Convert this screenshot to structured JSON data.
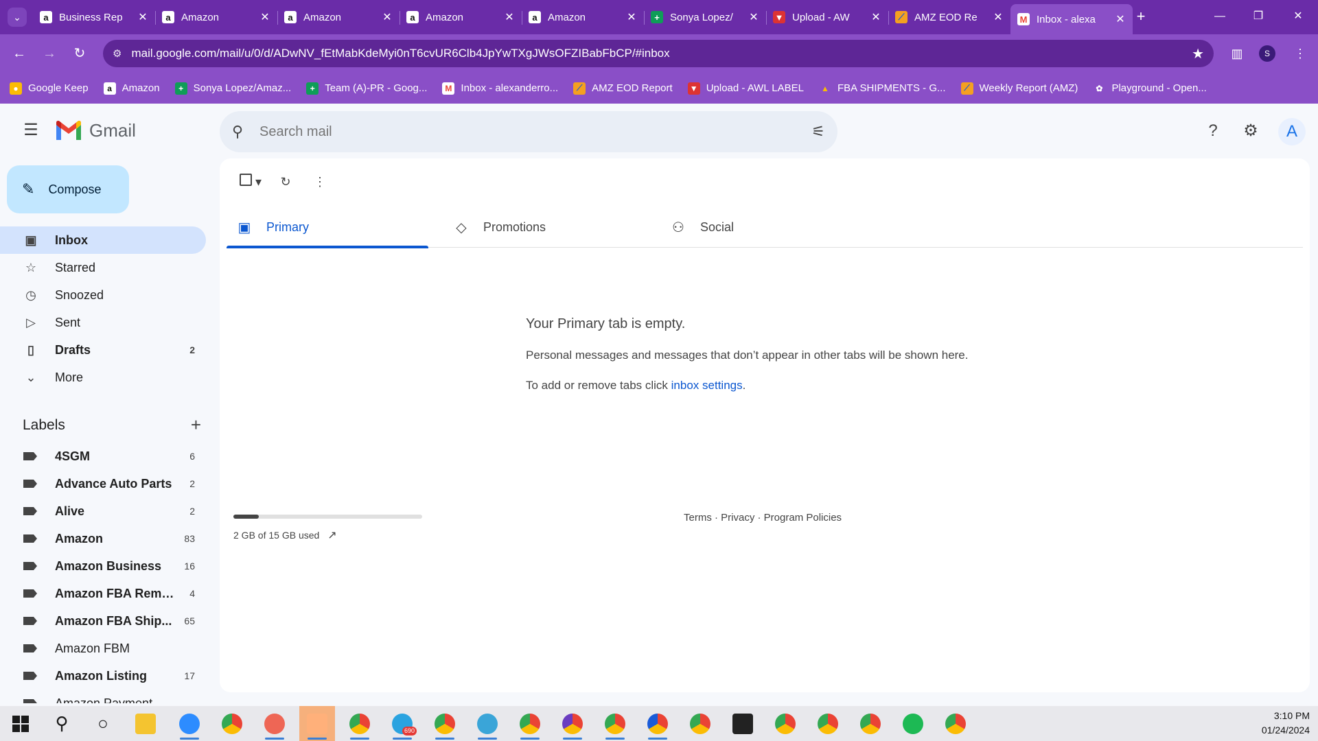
{
  "browser": {
    "tabs": [
      {
        "title": "Business Rep",
        "favicon": "amazon-icon"
      },
      {
        "title": "Amazon",
        "favicon": "amazon-icon"
      },
      {
        "title": "Amazon",
        "favicon": "amazon-icon"
      },
      {
        "title": "Amazon",
        "favicon": "amazon-icon"
      },
      {
        "title": "Amazon",
        "favicon": "amazon-icon"
      },
      {
        "title": "Sonya Lopez/",
        "favicon": "sheets-icon"
      },
      {
        "title": "Upload - AW",
        "favicon": "awl-icon"
      },
      {
        "title": "AMZ EOD Re",
        "favicon": "report-icon"
      },
      {
        "title": "Inbox - alexa",
        "favicon": "gmail-icon"
      }
    ],
    "active_tab_index": 8,
    "url": "mail.google.com/mail/u/0/d/ADwNV_fEtMabKdeMyi0nT6cvUR6Clb4JpYwTXgJWsOFZIBabFbCP/#inbox",
    "profile_initial": "S",
    "bookmarks": [
      {
        "label": "Google Keep",
        "icon": "keep-icon"
      },
      {
        "label": "Amazon",
        "icon": "amazon-icon"
      },
      {
        "label": "Sonya Lopez/Amaz...",
        "icon": "sheets-icon"
      },
      {
        "label": "Team (A)-PR - Goog...",
        "icon": "sheets-icon"
      },
      {
        "label": "Inbox - alexanderro...",
        "icon": "gmail-icon"
      },
      {
        "label": "AMZ EOD Report",
        "icon": "report-icon"
      },
      {
        "label": "Upload - AWL LABEL",
        "icon": "awl-icon"
      },
      {
        "label": "FBA SHIPMENTS - G...",
        "icon": "drive-icon"
      },
      {
        "label": "Weekly Report (AMZ)",
        "icon": "report-icon"
      },
      {
        "label": "Playground - Open...",
        "icon": "openai-icon"
      }
    ]
  },
  "gmail": {
    "logo_text": "Gmail",
    "search_placeholder": "Search mail",
    "avatar_initial": "A",
    "compose_label": "Compose",
    "nav": [
      {
        "label": "Inbox",
        "icon": "inbox-icon",
        "count": ""
      },
      {
        "label": "Starred",
        "icon": "star-icon",
        "count": ""
      },
      {
        "label": "Snoozed",
        "icon": "clock-icon",
        "count": ""
      },
      {
        "label": "Sent",
        "icon": "send-icon",
        "count": ""
      },
      {
        "label": "Drafts",
        "icon": "draft-icon",
        "count": "2"
      },
      {
        "label": "More",
        "icon": "chevron-down-icon",
        "count": ""
      }
    ],
    "labels_title": "Labels",
    "labels": [
      {
        "label": "4SGM",
        "count": "6",
        "bold": true
      },
      {
        "label": "Advance Auto Parts",
        "count": "2",
        "bold": true
      },
      {
        "label": "Alive",
        "count": "2",
        "bold": true
      },
      {
        "label": "Amazon",
        "count": "83",
        "bold": true
      },
      {
        "label": "Amazon Business",
        "count": "16",
        "bold": true
      },
      {
        "label": "Amazon FBA Remo...",
        "count": "4",
        "bold": true
      },
      {
        "label": "Amazon FBA Ship...",
        "count": "65",
        "bold": true
      },
      {
        "label": "Amazon FBM",
        "count": "",
        "bold": false
      },
      {
        "label": "Amazon Listing",
        "count": "17",
        "bold": true
      },
      {
        "label": "Amazon Payment",
        "count": "",
        "bold": false
      }
    ],
    "tabs": [
      {
        "label": "Primary",
        "icon": "inbox-tab-icon"
      },
      {
        "label": "Promotions",
        "icon": "tag-icon"
      },
      {
        "label": "Social",
        "icon": "people-icon"
      }
    ],
    "empty": {
      "title": "Your Primary tab is empty.",
      "line1": "Personal messages and messages that don’t appear in other tabs will be shown here.",
      "line2_prefix": "To add or remove tabs click ",
      "line2_link": "inbox settings",
      "line2_suffix": "."
    },
    "storage": {
      "text": "2 GB of 15 GB used",
      "used_fraction": 0.133
    },
    "footer": "Terms · Privacy · Program Policies"
  },
  "taskbar": {
    "time": "3:10 PM",
    "date": "01/24/2024",
    "telegram_badge": "690"
  }
}
